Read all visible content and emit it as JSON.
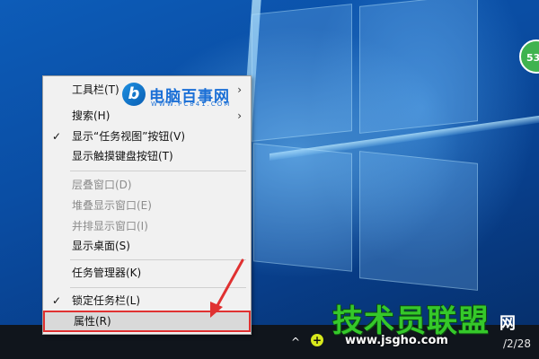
{
  "desktop": {
    "badge_text": "53"
  },
  "context_menu": {
    "items": [
      {
        "label": "工具栏(T)",
        "submenu": true
      },
      {
        "label": "搜索(H)",
        "submenu": true
      },
      {
        "label": "显示“任务视图”按钮(V)",
        "checked": true
      },
      {
        "label": "显示触摸键盘按钮(T)"
      },
      {
        "label": "层叠窗口(D)",
        "disabled": true
      },
      {
        "label": "堆叠显示窗口(E)",
        "disabled": true
      },
      {
        "label": "并排显示窗口(I)",
        "disabled": true
      },
      {
        "label": "显示桌面(S)"
      },
      {
        "label": "任务管理器(K)"
      },
      {
        "label": "锁定任务栏(L)",
        "checked": true
      },
      {
        "label": "属性(R)",
        "highlighted": true
      }
    ],
    "check_glyph": "✓",
    "submenu_glyph": "›"
  },
  "watermark_logo": {
    "mark": "b",
    "name": "电脑百事网",
    "url": "WWW.PC841.COM"
  },
  "watermark_site": {
    "name": "技术员联盟",
    "net": "网",
    "url": "www.jsgho.com"
  },
  "tray": {
    "chevron": "^",
    "icon_glyph": "+",
    "clock": "/2/28"
  },
  "colors": {
    "highlight_border": "#e03131",
    "arrow": "#e03131",
    "badge": "#3fb34f"
  }
}
